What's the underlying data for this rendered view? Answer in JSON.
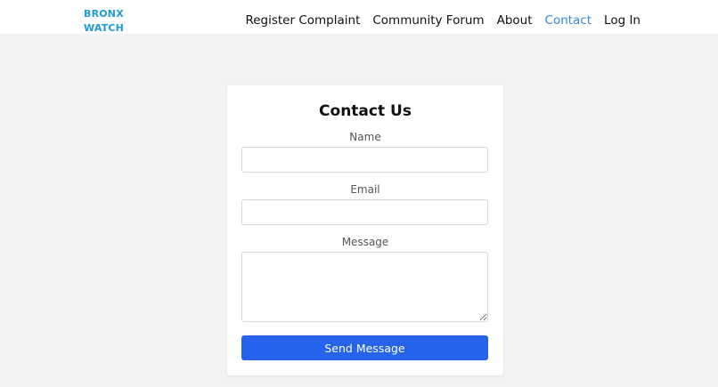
{
  "brand": {
    "line1": "BRONX",
    "line2": "WATCH"
  },
  "nav": {
    "items": [
      {
        "label": "Register Complaint"
      },
      {
        "label": "Community Forum"
      },
      {
        "label": "About"
      },
      {
        "label": "Contact",
        "active": true
      },
      {
        "label": "Log In"
      }
    ]
  },
  "contact_form": {
    "title": "Contact Us",
    "name_label": "Name",
    "name_value": "",
    "email_label": "Email",
    "email_value": "",
    "message_label": "Message",
    "message_value": "",
    "submit_label": "Send Message"
  },
  "colors": {
    "brand": "#1e9bd8",
    "nav_active": "#3a86d8",
    "button": "#2563eb",
    "page_background": "#f2f3f5"
  }
}
